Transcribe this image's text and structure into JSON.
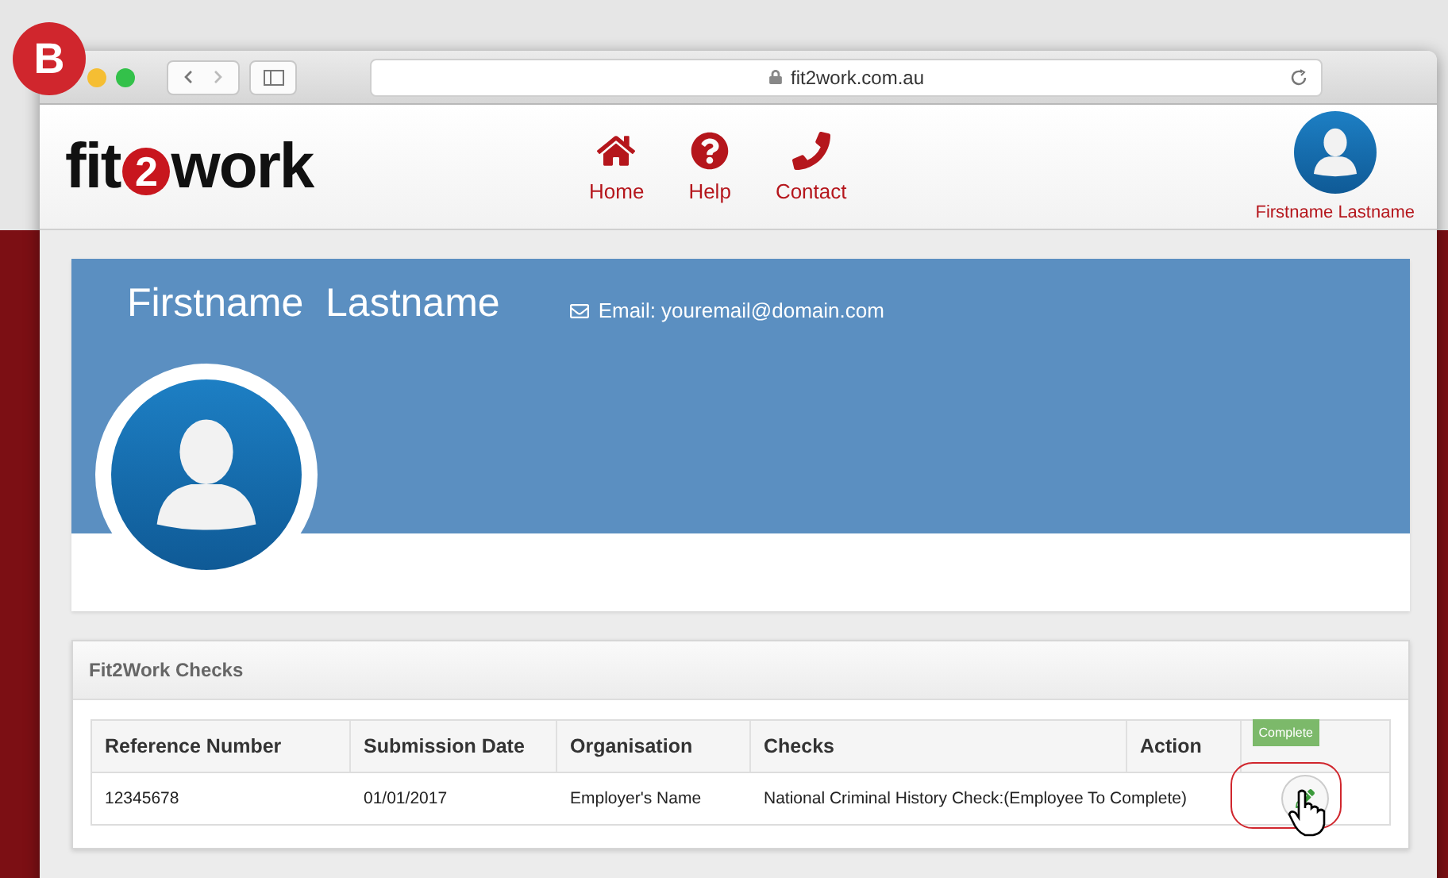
{
  "badge": "B",
  "browser": {
    "url": "fit2work.com.au"
  },
  "header": {
    "logo": {
      "part_1": "fit",
      "part_2": "2",
      "part_3": "work"
    },
    "nav": [
      {
        "kind": "home",
        "label": "Home"
      },
      {
        "kind": "help",
        "label": "Help"
      },
      {
        "kind": "phone",
        "label": "Contact"
      }
    ],
    "user_name": "Firstname Lastname"
  },
  "profile": {
    "name": "Firstname  Lastname",
    "email": "Email: youremail@domain.com"
  },
  "checks": {
    "title": "Fit2Work Checks",
    "columns": [
      "Reference Number",
      "Submission Date",
      "Organisation",
      "Checks",
      "Action"
    ],
    "rows": [
      {
        "cells": [
          "12345678",
          "01/01/2017",
          "Employer's Name",
          "National Criminal History Check:(Employee To Complete)"
        ],
        "action": {
          "tooltip": "Complete",
          "highlighted": true
        }
      }
    ]
  }
}
